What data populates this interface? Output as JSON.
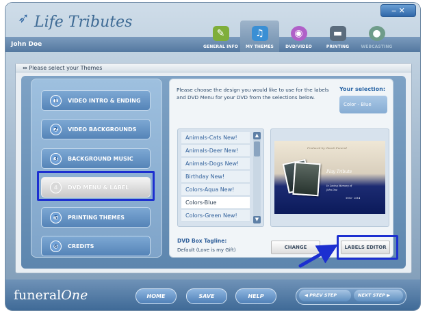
{
  "app": {
    "brand": "Life Tributes",
    "user": "John Doe",
    "window_controls": "‒  ✕"
  },
  "tabs": [
    {
      "label": "GENERAL INFO",
      "icon": "document-edit-icon",
      "color": "#7fae3a",
      "state": "normal"
    },
    {
      "label": "MY THEMES",
      "icon": "music-note-icon",
      "color": "#3a8fd4",
      "state": "active"
    },
    {
      "label": "DVD/VIDEO",
      "icon": "disc-icon",
      "color": "#b060c8",
      "state": "normal"
    },
    {
      "label": "PRINTING",
      "icon": "printer-icon",
      "color": "#5b6c7d",
      "state": "normal"
    },
    {
      "label": "WEBCASTING",
      "icon": "webcam-icon",
      "color": "#6f9c8a",
      "state": "disabled"
    }
  ],
  "panel": {
    "title": "Please select your Themes"
  },
  "steps": [
    {
      "num": "1",
      "label": "VIDEO INTRO & ENDING"
    },
    {
      "num": "2",
      "label": "VIDEO BACKGROUNDS"
    },
    {
      "num": "3",
      "label": "BACKGROUND MUSIC"
    },
    {
      "num": "4",
      "label": "DVD MENU & LABEL",
      "selected": true
    },
    {
      "num": "5",
      "label": "PRINTING THEMES"
    },
    {
      "num": "6",
      "label": "CREDITS"
    }
  ],
  "main": {
    "instructions": "Please choose the design you would like to use for the labels and DVD Menu for your DVD from the selections below.",
    "selection_label": "Your selection:",
    "selection_value": "Color - Blue",
    "themes": [
      "Animals-Cats New!",
      "Animals-Deer New!",
      "Animals-Dogs New!",
      "Birthday New!",
      "Colors-Aqua New!",
      "Colors-Blue",
      "Colors-Green New!"
    ],
    "active_theme_index": 5,
    "preview": {
      "top_text": "Produced by: Roach Funeral",
      "title": "Play Tribute",
      "memory_line1": "In Loving Memory of",
      "memory_line2": "John Doe",
      "dates": "1953 - 2014"
    },
    "tagline_label": "DVD Box Tagline:",
    "tagline_value": "Default (Love is my Gift)",
    "change_button": "CHANGE",
    "labels_editor_button": "LABELS EDITOR"
  },
  "footer": {
    "brand_plain": "funeral",
    "brand_italic": "One",
    "home": "HOME",
    "save": "SAVE",
    "help": "HELP",
    "prev": "PREV STEP",
    "next": "NEXT STEP"
  },
  "colors": {
    "highlight": "#1c2fd0",
    "accent": "#2f69a7"
  }
}
